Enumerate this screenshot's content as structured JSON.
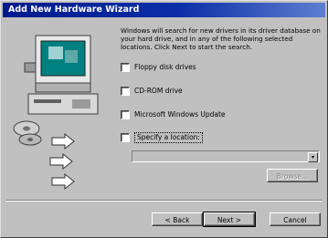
{
  "window": {
    "title": "Add New Hardware Wizard"
  },
  "main": {
    "description": "Windows will search for new drivers in its driver database on your hard drive, and in any of the following selected locations. Click Next to start the search.",
    "options": [
      {
        "label": "Floppy disk drives",
        "checked": false
      },
      {
        "label": "CD-ROM drive",
        "checked": false
      },
      {
        "label": "Microsoft Windows Update",
        "checked": false
      },
      {
        "label": "Specify a location:",
        "checked": false
      }
    ],
    "location_value": "",
    "browse_label": "Browse..."
  },
  "buttons": {
    "back_label": "< Back",
    "next_label": "Next >",
    "cancel_label": "Cancel"
  },
  "colors": {
    "face": "#c0c0c0",
    "titlebar": "#0b2fa8",
    "accent": "#008080"
  },
  "icons": [
    "computer-monitor-icon",
    "cd-disc-icon",
    "arrow-icon"
  ]
}
